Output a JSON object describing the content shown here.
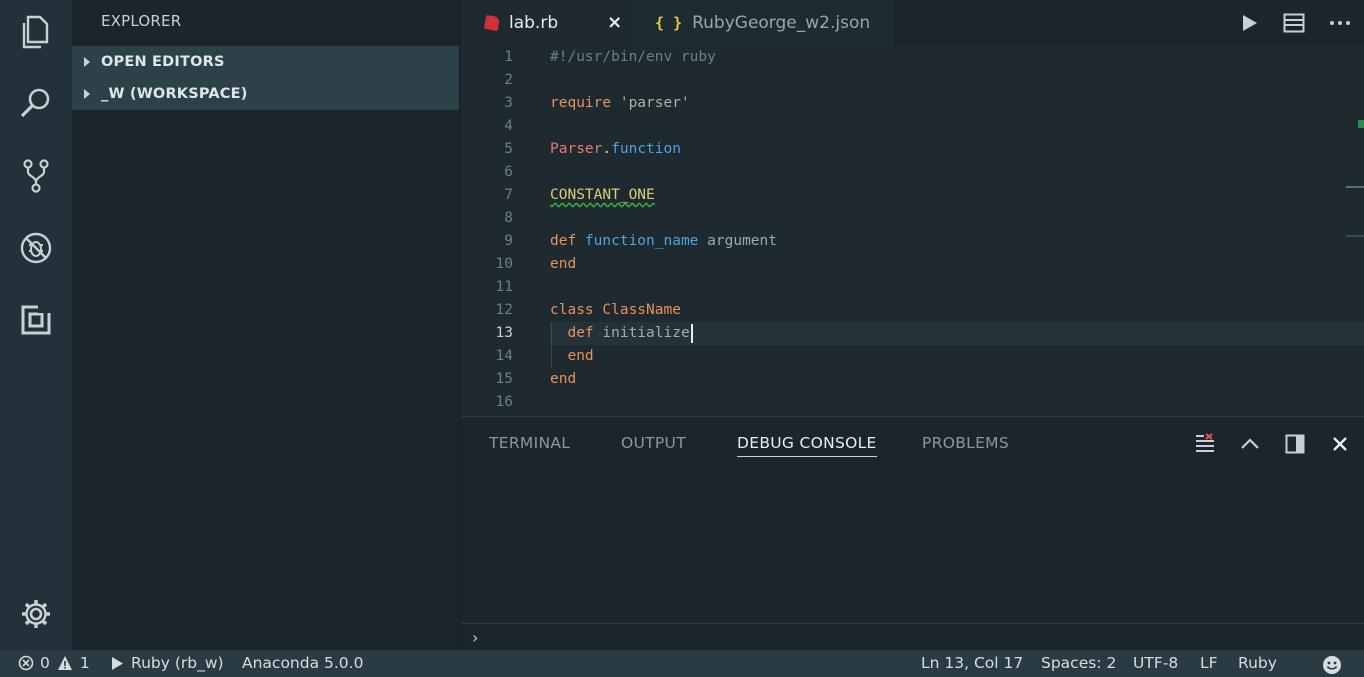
{
  "sidebar": {
    "title": "EXPLORER",
    "sections": [
      {
        "label": "OPEN EDITORS"
      },
      {
        "label": "_W (WORKSPACE)"
      }
    ]
  },
  "tabs": [
    {
      "label": "lab.rb",
      "close": "×"
    },
    {
      "label": "RubyGeorge_w2.json",
      "icon": "{ }"
    }
  ],
  "editor": {
    "lines": [
      {
        "n": "1",
        "parts": [
          {
            "t": "#!/usr/bin/env ruby",
            "c": "t-comment"
          }
        ]
      },
      {
        "n": "2",
        "parts": []
      },
      {
        "n": "3",
        "parts": [
          {
            "t": "require ",
            "c": "t-kw"
          },
          {
            "t": "'parser'",
            "c": "t-str"
          }
        ]
      },
      {
        "n": "4",
        "parts": []
      },
      {
        "n": "5",
        "parts": [
          {
            "t": "Parser",
            "c": "t-const"
          },
          {
            "t": ".",
            "c": "t-plain"
          },
          {
            "t": "function",
            "c": "t-fn"
          }
        ]
      },
      {
        "n": "6",
        "parts": []
      },
      {
        "n": "7",
        "parts": [
          {
            "t": "CONSTANT_ONE",
            "c": "t-yel"
          }
        ]
      },
      {
        "n": "8",
        "parts": []
      },
      {
        "n": "9",
        "parts": [
          {
            "t": "def ",
            "c": "t-kw"
          },
          {
            "t": "function_name",
            "c": "t-fn"
          },
          {
            "t": " argument",
            "c": "t-arg"
          }
        ]
      },
      {
        "n": "10",
        "parts": [
          {
            "t": "end",
            "c": "t-kw"
          }
        ]
      },
      {
        "n": "11",
        "parts": []
      },
      {
        "n": "12",
        "parts": [
          {
            "t": "class ",
            "c": "t-kw"
          },
          {
            "t": "ClassName",
            "c": "t-cls"
          }
        ]
      },
      {
        "n": "13",
        "parts": [
          {
            "t": "  def ",
            "c": "t-kw"
          },
          {
            "t": "initialize",
            "c": "t-init"
          }
        ]
      },
      {
        "n": "14",
        "parts": [
          {
            "t": "  end",
            "c": "t-kw"
          }
        ]
      },
      {
        "n": "15",
        "parts": [
          {
            "t": "end",
            "c": "t-kw"
          }
        ]
      },
      {
        "n": "16",
        "parts": []
      }
    ]
  },
  "panel": {
    "tabs": [
      "TERMINAL",
      "OUTPUT",
      "DEBUG CONSOLE",
      "PROBLEMS"
    ],
    "prompt": "›"
  },
  "status": {
    "errors": "0",
    "warnings": "1",
    "run_config": "Ruby (rb_w)",
    "interpreter": "Anaconda 5.0.0",
    "position": "Ln 13, Col 17",
    "indent": "Spaces: 2",
    "encoding": "UTF-8",
    "eol": "LF",
    "language": "Ruby"
  },
  "colors": {
    "accent_ruby": "#d32f3a",
    "json_icon": "#e6c84a",
    "status_bg": "#2a3b43"
  }
}
